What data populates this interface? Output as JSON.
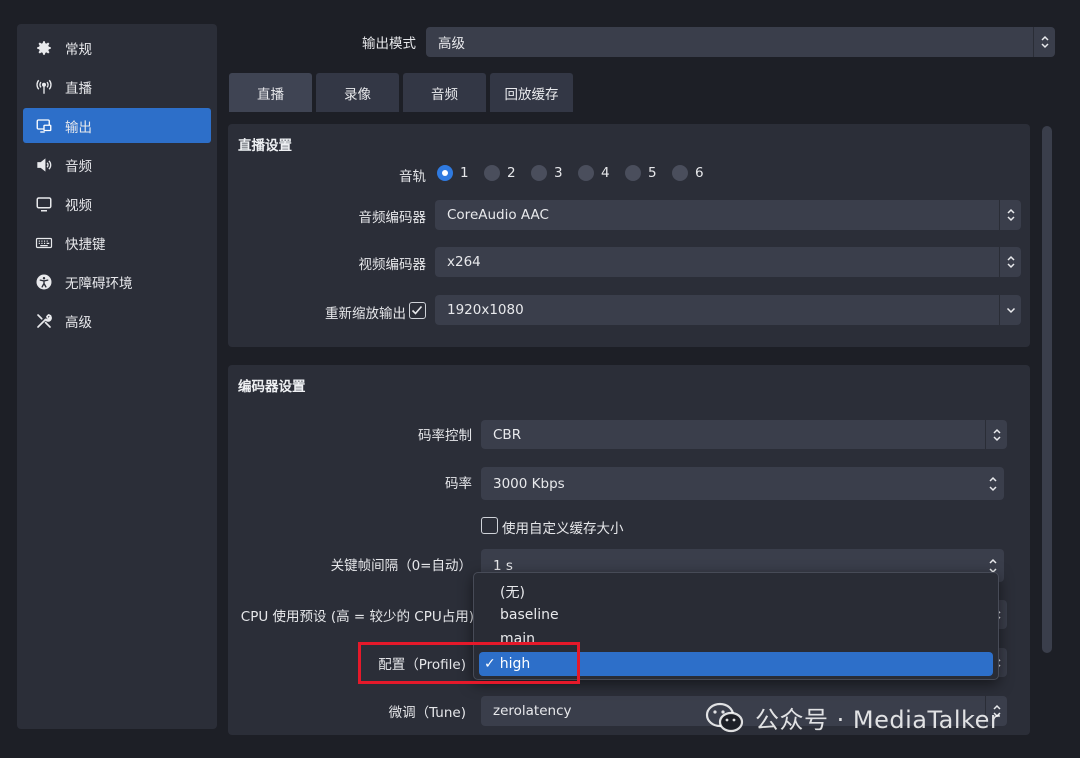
{
  "sidebar": {
    "items": [
      {
        "label": "常规",
        "icon": "gear-icon"
      },
      {
        "label": "直播",
        "icon": "antenna-icon"
      },
      {
        "label": "输出",
        "icon": "output-icon"
      },
      {
        "label": "音频",
        "icon": "speaker-icon"
      },
      {
        "label": "视频",
        "icon": "monitor-icon"
      },
      {
        "label": "快捷键",
        "icon": "keyboard-icon"
      },
      {
        "label": "无障碍环境",
        "icon": "accessibility-icon"
      },
      {
        "label": "高级",
        "icon": "tools-icon"
      }
    ],
    "active_index": 2
  },
  "output_mode": {
    "label": "输出模式",
    "value": "高级"
  },
  "tabs": [
    "直播",
    "录像",
    "音频",
    "回放缓存"
  ],
  "stream_settings": {
    "title": "直播设置",
    "audio_track_label": "音轨",
    "tracks": [
      "1",
      "2",
      "3",
      "4",
      "5",
      "6"
    ],
    "selected_track": "1",
    "audio_encoder_label": "音频编码器",
    "audio_encoder_value": "CoreAudio AAC",
    "video_encoder_label": "视频编码器",
    "video_encoder_value": "x264",
    "rescale_label": "重新缩放输出",
    "rescale_checked": true,
    "rescale_value": "1920x1080"
  },
  "encoder_settings": {
    "title": "编码器设置",
    "rate_control_label": "码率控制",
    "rate_control_value": "CBR",
    "bitrate_label": "码率",
    "bitrate_value": "3000 Kbps",
    "custom_buffer_label": "使用自定义缓存大小",
    "custom_buffer_checked": false,
    "keyframe_label": "关键帧间隔（0=自动）",
    "keyframe_value": "1 s",
    "cpu_preset_label": "CPU 使用预设 (高 = 较少的 CPU占用)",
    "profile_label": "配置（Profile)",
    "tune_label": "微调（Tune)",
    "tune_value": "zerolatency"
  },
  "profile_dropdown": {
    "options": [
      "(无)",
      "baseline",
      "main",
      "high"
    ],
    "selected": "high",
    "check": "✓"
  },
  "watermark": "公众号 · MediaTalker",
  "colors": {
    "accent": "#2d6fc9",
    "highlight_box": "#e5192a"
  }
}
